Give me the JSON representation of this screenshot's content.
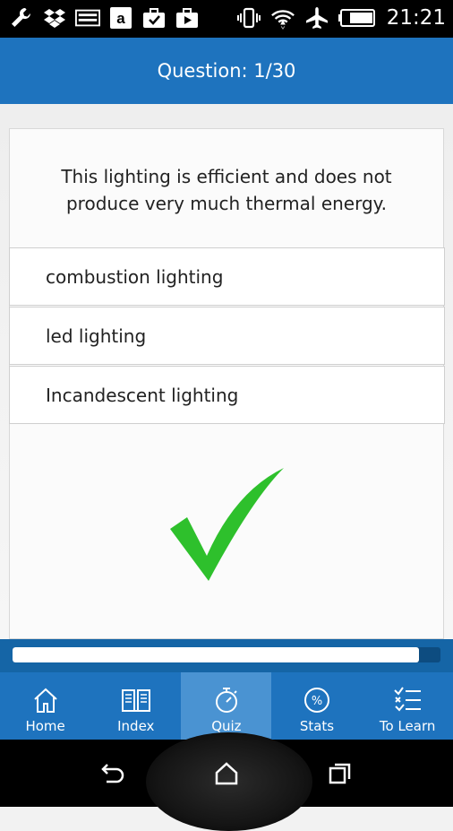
{
  "status_bar": {
    "time": "21:21",
    "left_icons": [
      "wrench-icon",
      "dropbox-icon",
      "card-icon",
      "amazon-icon",
      "briefcase-icon",
      "briefcase-play-icon"
    ],
    "right_icons": [
      "vibrate-icon",
      "wifi-icon",
      "airplane-icon",
      "battery-icon"
    ]
  },
  "header": {
    "title": "Question: 1/30"
  },
  "quiz": {
    "question": "This lighting is efficient and does not produce very much thermal energy.",
    "answers": [
      {
        "label": "combustion lighting"
      },
      {
        "label": "led lighting"
      },
      {
        "label": "Incandescent lighting"
      }
    ],
    "result_icon": "checkmark-icon",
    "result_color": "#2ec02c"
  },
  "progress": {
    "fraction": 0.95
  },
  "nav": {
    "items": [
      {
        "label": "Home",
        "icon": "home-icon",
        "active": false
      },
      {
        "label": "Index",
        "icon": "book-icon",
        "active": false
      },
      {
        "label": "Quiz",
        "icon": "stopwatch-icon",
        "active": true
      },
      {
        "label": "Stats",
        "icon": "percent-icon",
        "active": false
      },
      {
        "label": "To Learn",
        "icon": "checklist-icon",
        "active": false
      }
    ]
  },
  "colors": {
    "accent": "#1e73be",
    "active_tab": "#4a93d2"
  },
  "system_nav": [
    "back-icon",
    "home-nav-icon",
    "recents-icon"
  ]
}
